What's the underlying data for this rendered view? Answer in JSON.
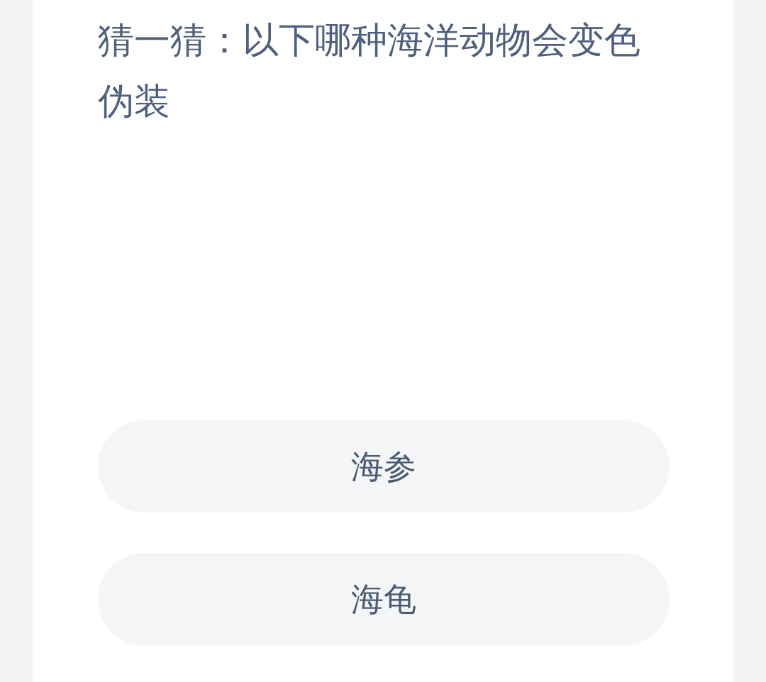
{
  "question": "猜一猜：以下哪种海洋动物会变色伪装",
  "options": [
    {
      "label": "海参"
    },
    {
      "label": "海龟"
    }
  ]
}
